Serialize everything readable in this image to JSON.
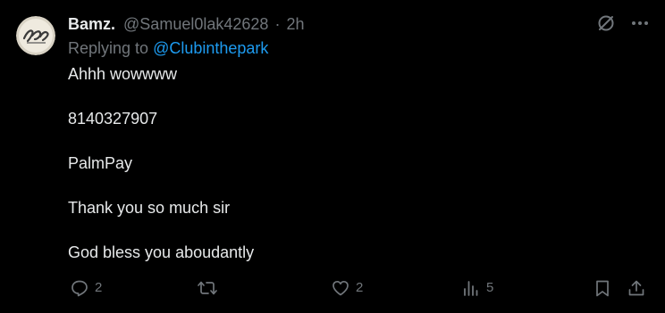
{
  "post": {
    "display_name": "Bamz.",
    "handle": "@Samuel0lak42628",
    "time": "2h",
    "separator": "·",
    "replying_prefix": "Replying to ",
    "replying_to": "@Clubinthepark",
    "avatar_icon": "bamz-logo-avatar",
    "lines": [
      "Ahhh wowwww",
      "8140327907",
      "PalmPay",
      "Thank you so much sir",
      "God bless you aboudantly"
    ]
  },
  "top_actions": {
    "grok_icon": "slashed-circle-icon",
    "more_icon": "more-horizontal-icon"
  },
  "actions": {
    "reply_count": "2",
    "repost_count": "",
    "like_count": "2",
    "views_count": "5"
  },
  "colors": {
    "background": "#000000",
    "text": "#e7e9ea",
    "muted": "#71767b",
    "link": "#1d9bf0"
  }
}
